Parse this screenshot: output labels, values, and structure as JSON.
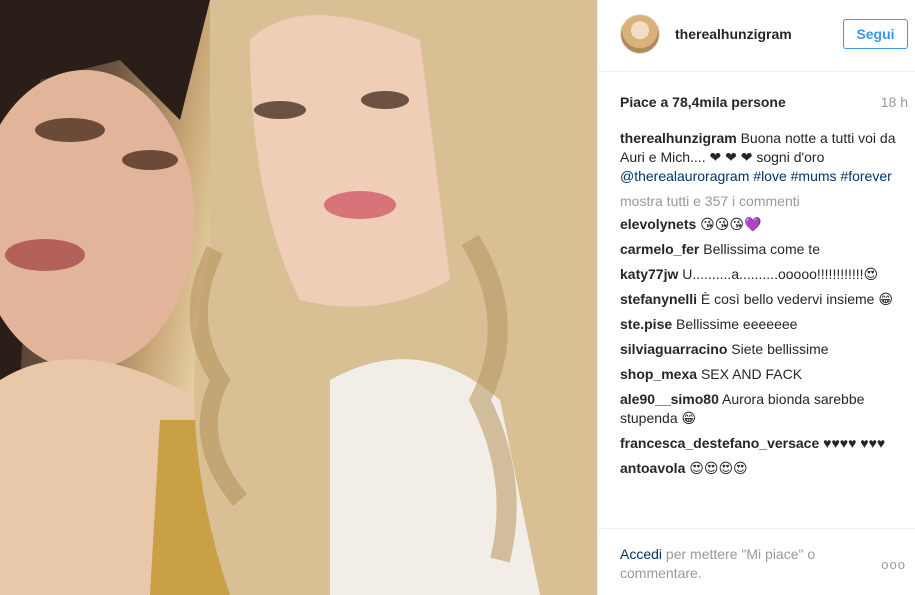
{
  "post": {
    "username": "therealhunzigram",
    "follow_label": "Segui",
    "likes_text": "Piace a 78,4mila persone",
    "time_ago": "18 h",
    "caption": {
      "user": "therealhunzigram",
      "text": "Buona notte a tutti voi da Auri e Mich.... ❤ ❤ ❤ sogni d'oro",
      "mention": "@therealauroragram",
      "hashtags": "#love #mums #forever"
    },
    "show_all_comments": "mostra tutti e 357 i commenti",
    "comments": [
      {
        "user": "elevolynets",
        "text": "😘😘😘💜"
      },
      {
        "user": "carmelo_fer",
        "text": "Bellissima come te"
      },
      {
        "user": "katy77jw",
        "text": "U..........a..........ooooo!!!!!!!!!!!!😍"
      },
      {
        "user": "stefanynelli",
        "text": "È così bello vedervi insieme 😁"
      },
      {
        "user": "ste.pise",
        "text": "Bellissime eeeeeee"
      },
      {
        "user": "silviaguarracino",
        "text": "Siete bellissime"
      },
      {
        "user": "shop_mexa",
        "text": "SEX AND FACK"
      },
      {
        "user": "ale90__simo80",
        "text": "Aurora bionda sarebbe stupenda 😁"
      },
      {
        "user": "francesca_destefano_versace",
        "text": "♥♥♥♥ ♥♥♥"
      },
      {
        "user": "antoavola",
        "text": "😍😍😍😍"
      }
    ],
    "footer": {
      "login_link": "Accedi",
      "login_rest": "per mettere \"Mi piace\" o commentare.",
      "more_icon": "ooo"
    }
  }
}
